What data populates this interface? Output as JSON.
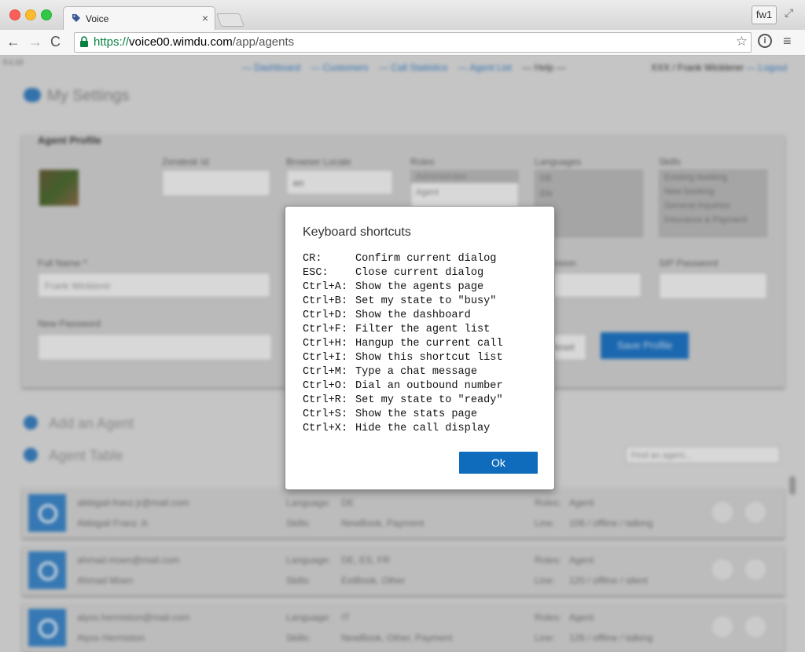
{
  "browser": {
    "tab_title": "Voice",
    "tab_close": "×",
    "profile_button": "fw1",
    "url_scheme": "https://",
    "url_host": "voice00.wimdu.com",
    "url_path": "/app/agents",
    "back_glyph": "←",
    "forward_glyph": "→",
    "reload_glyph": "C",
    "star_glyph": "☆",
    "info_glyph": "i",
    "menu_glyph": "≡",
    "fullscreen_glyph": "⤢"
  },
  "page": {
    "version": "0.1.13",
    "nav": [
      "— Dashboard",
      "— Customers",
      "— Call Statistics",
      "— Agent List",
      "— Help —"
    ],
    "user": "XXX / Frank Wicklerer",
    "logout": "— Logout",
    "settings_title": "My Settings",
    "profile_title": "Agent Profile",
    "labels": {
      "zendesk": "Zendesk Id",
      "locale": "Browser Locale",
      "roles": "Roles",
      "languages": "Languages",
      "skills": "Skills",
      "full_name": "Full Name *",
      "extension": "Extension",
      "sip_password": "SIP Password",
      "new_password": "New Password"
    },
    "locale_value": "en",
    "full_name_value": "Frank Wicklerer",
    "extension_value": "1",
    "roles_options": [
      "Administrator",
      "Agent"
    ],
    "languages_options": [
      "DE",
      "EN"
    ],
    "skills_options": [
      "Existing booking",
      "New booking",
      "General inquiries",
      "Insurance & Payment"
    ],
    "reset_button": "Reset",
    "save_button": "Save Profile",
    "add_agent": "Add an Agent",
    "agent_table": "Agent Table",
    "find_agent_placeholder": "Find an agent...",
    "agents": [
      {
        "email": "abbigail-franz.jr@mail.com",
        "name": "Abbigail Franz Jr.",
        "language_label": "Language:",
        "language": "DE",
        "skills_label": "Skills:",
        "skills": "NewBook, Payment",
        "roles_label": "Roles:",
        "roles": "Agent",
        "line_label": "Line:",
        "line": "106 / offline / talking"
      },
      {
        "email": "ahmad.moen@mail.com",
        "name": "Ahmad Moen",
        "language_label": "Language:",
        "language": "DE, ES, FR",
        "skills_label": "Skills:",
        "skills": "ExtBook, Other",
        "roles_label": "Roles:",
        "roles": "Agent",
        "line_label": "Line:",
        "line": "120 / offline / silent"
      },
      {
        "email": "alyss.hermiston@mail.com",
        "name": "Alyss Hermiston",
        "language_label": "Language:",
        "language": "IT",
        "skills_label": "Skills:",
        "skills": "NewBook, Other, Payment",
        "roles_label": "Roles:",
        "roles": "Agent",
        "line_label": "Line:",
        "line": "126 / offline / talking"
      }
    ]
  },
  "modal": {
    "title": "Keyboard shortcuts",
    "shortcuts": [
      {
        "key": "CR:",
        "action": "Confirm current dialog"
      },
      {
        "key": "ESC:",
        "action": "Close current dialog"
      },
      {
        "key": "Ctrl+A:",
        "action": "Show the agents page"
      },
      {
        "key": "Ctrl+B:",
        "action": "Set my state to \"busy\""
      },
      {
        "key": "Ctrl+D:",
        "action": "Show the dashboard"
      },
      {
        "key": "Ctrl+F:",
        "action": "Filter the agent list"
      },
      {
        "key": "Ctrl+H:",
        "action": "Hangup the current call"
      },
      {
        "key": "Ctrl+I:",
        "action": "Show this shortcut list"
      },
      {
        "key": "Ctrl+M:",
        "action": "Type a chat message"
      },
      {
        "key": "Ctrl+O:",
        "action": "Dial an outbound number"
      },
      {
        "key": "Ctrl+R:",
        "action": "Set my state to \"ready\""
      },
      {
        "key": "Ctrl+S:",
        "action": "Show the stats page"
      },
      {
        "key": "Ctrl+X:",
        "action": "Hide the call display"
      }
    ],
    "ok_label": "Ok"
  },
  "colors": {
    "accent": "#0f6cbd",
    "url_scheme": "#0b8043"
  }
}
